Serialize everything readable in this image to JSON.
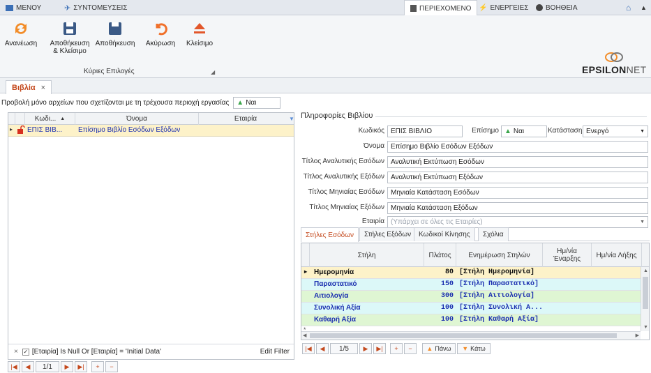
{
  "menu": {
    "menu_label": "ΜΕΝΟΥ",
    "shortcuts_label": "ΣΥΝΤΟΜΕΥΣΕΙΣ",
    "content_label": "ΠΕΡΙΕΧΟΜΕΝΟ",
    "actions_label": "ΕΝΕΡΓΕΙΕΣ",
    "help_label": "ΒΟΗΘΕΙΑ"
  },
  "ribbon": {
    "refresh": "Ανανέωση",
    "save_close_1": "Αποθήκευση",
    "save_close_2": "& Κλείσιμο",
    "save": "Αποθήκευση",
    "cancel": "Ακύρωση",
    "close": "Κλείσιμο",
    "group_label": "Κύριες Επιλογές"
  },
  "brand": {
    "part1": "EPSILON",
    "part2": "NET"
  },
  "doc_tab": {
    "label": "Βιβλία",
    "close": "×"
  },
  "filter": {
    "label": "Προβολή μόνο αρχείων που σχετίζονται με τη τρέχουσα περιοχή εργασίας",
    "value": "Ναι"
  },
  "left_grid": {
    "headers": [
      "Κωδι...",
      "Όνομα",
      "Εταιρία"
    ],
    "row": {
      "code": "ΕΠΙΣ ΒΙΒ...",
      "name": "Επίσημο Βιβλίο Εσόδων Εξόδων"
    },
    "filter_text": "[Εταιρία] Is Null Or [Εταιρία] = 'Initial Data'",
    "edit_filter": "Edit Filter",
    "nav_pos": "1/1"
  },
  "info": {
    "title": "Πληροφορίες Βιβλίου",
    "code_label": "Κωδικός",
    "code_value": "ΕΠΙΣ ΒΙΒΛΙΟ",
    "official_label": "Επίσημο",
    "official_value": "Ναι",
    "status_label": "Κατάσταση",
    "status_value": "Ενεργό",
    "name_label": "Όνομα",
    "name_value": "Επίσημο Βιβλίο Εσόδων Εξόδων",
    "t1_label": "Τίτλος Αναλυτικής Εσόδων",
    "t1_value": "Αναλυτική Εκτύπωση Εσόδων",
    "t2_label": "Τίτλος Αναλυτικής Εξόδων",
    "t2_value": "Αναλυτική Εκτύπωση Εξόδων",
    "t3_label": "Τίτλος Μηνιαίας Εσόδων",
    "t3_value": "Μηνιαία Κατάσταση Εσόδων",
    "t4_label": "Τίτλος Μηνιαίας Εξόδων",
    "t4_value": "Μηνιαία Κατάσταση Εξόδων",
    "company_label": "Εταιρία",
    "company_placeholder": "(Υπάρχει σε όλες τις Εταιρίες)"
  },
  "subtabs": [
    "Στήλες Εσόδων",
    "Στήλες Εξόδων",
    "Κωδικοί Κίνησης",
    "Σχόλια"
  ],
  "right_grid": {
    "headers": [
      "Στήλη",
      "Πλάτος",
      "Ενημέρωση Στηλών",
      "Ημ/νία Έναρξης",
      "Ημ/νία Λήξης"
    ],
    "rows": [
      {
        "col": "Ημερομηνία",
        "width": "80",
        "update": "[Στήλη Ημερομηνία]"
      },
      {
        "col": "Παραστατικό",
        "width": "150",
        "update": "[Στήλη Παραστατικό]"
      },
      {
        "col": "Αιτιολογία",
        "width": "300",
        "update": "[Στήλη Αιτιολογία]"
      },
      {
        "col": "Συνολική Αξία",
        "width": "100",
        "update": "[Στήλη Συνολική Α..."
      },
      {
        "col": "Καθαρή Αξία",
        "width": "100",
        "update": "[Στήλη Καθαρή Αξία]"
      }
    ],
    "nav_pos": "1/5",
    "up": "Πάνω",
    "down": "Κάτω"
  }
}
